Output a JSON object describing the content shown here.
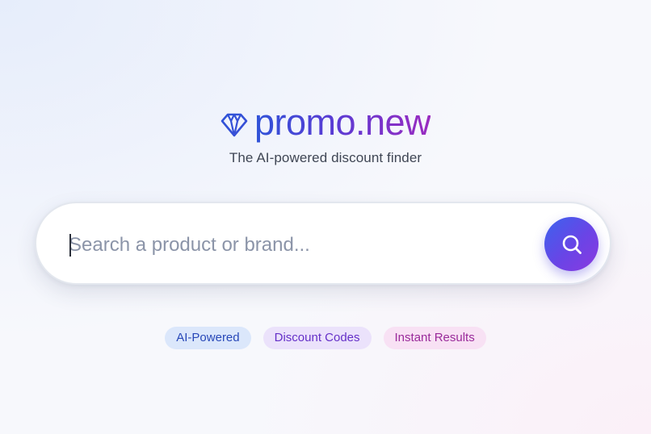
{
  "logo": {
    "text": "promo.new",
    "icon": "diamond-icon"
  },
  "tagline": "The AI-powered discount finder",
  "search": {
    "placeholder": "Search a product or brand...",
    "value": "",
    "button_icon": "search-icon"
  },
  "badges": [
    {
      "label": "AI-Powered",
      "color": "#2848b8",
      "background": "#dbe7fb"
    },
    {
      "label": "Discount Codes",
      "color": "#6530c8",
      "background": "#ebe2fb"
    },
    {
      "label": "Instant Results",
      "color": "#9a2a9a",
      "background": "#f8e1f4"
    }
  ],
  "colors": {
    "brand_gradient_start": "#2f53d8",
    "brand_gradient_end": "#9a2bc0",
    "button_gradient_start": "#3b63ee",
    "button_gradient_end": "#8a3ae0"
  }
}
